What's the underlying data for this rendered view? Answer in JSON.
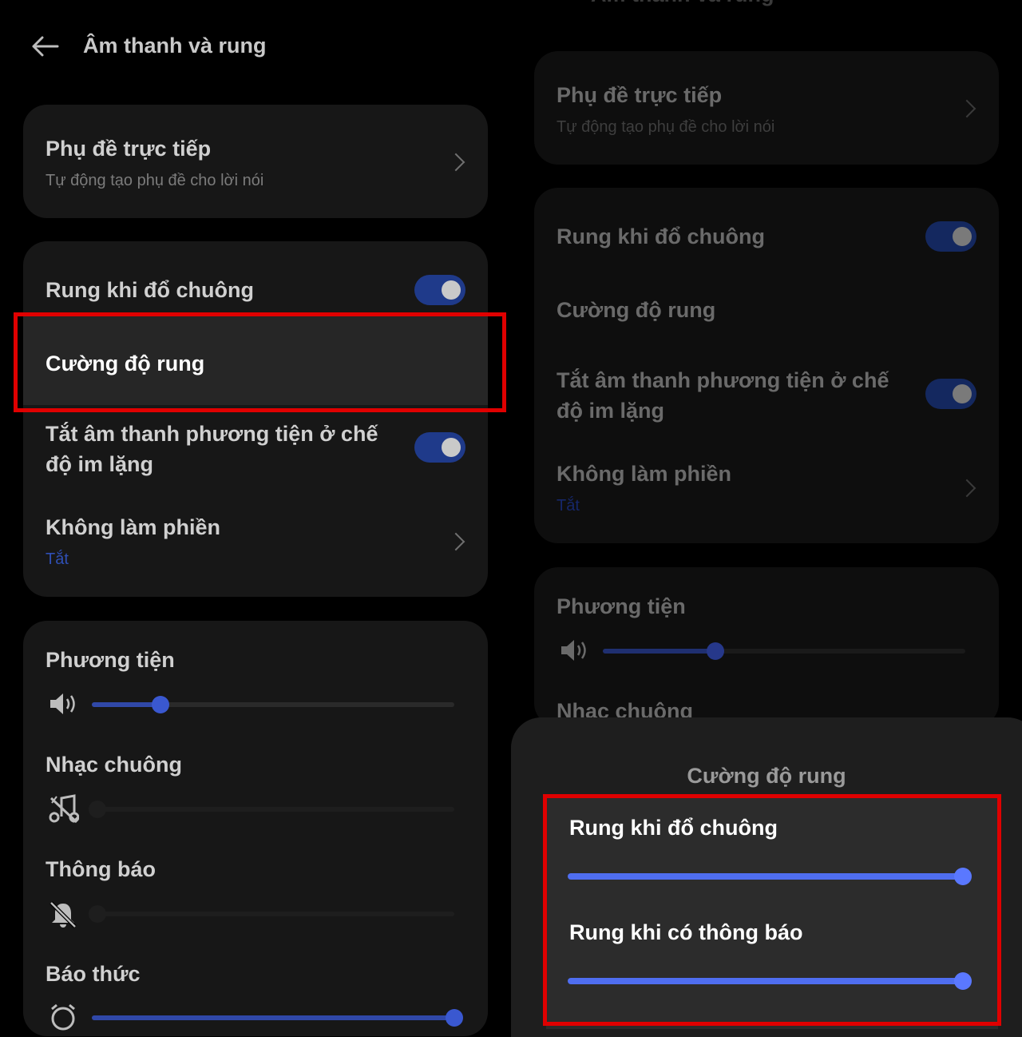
{
  "left": {
    "header": {
      "title": "Âm thanh và rung",
      "back_icon": "back-arrow-icon"
    },
    "live_caption": {
      "title": "Phụ đề trực tiếp",
      "subtitle": "Tự động tạo phụ đề cho lời nói"
    },
    "vibrate_ring": {
      "label": "Rung khi đổ chuông",
      "on": true
    },
    "vibration_intensity": {
      "label": "Cường độ rung"
    },
    "mute_media": {
      "label_line1": "Tắt âm thanh phương tiện ở chế",
      "label_line2": "độ im lặng",
      "on": true
    },
    "dnd": {
      "title": "Không làm phiền",
      "status": "Tắt"
    },
    "volumes": [
      {
        "label": "Phương tiện",
        "icon": "speaker-icon",
        "level": 0.19
      },
      {
        "label": "Nhạc chuông",
        "icon": "ringtone-muted-icon",
        "level": 0.0
      },
      {
        "label": "Thông báo",
        "icon": "notification-muted-icon",
        "level": 0.0
      },
      {
        "label": "Báo thức",
        "icon": "alarm-icon",
        "level": 1.0
      }
    ]
  },
  "right": {
    "header": {
      "title": "Âm thanh và rung"
    },
    "live_caption": {
      "title": "Phụ đề trực tiếp",
      "subtitle": "Tự động tạo phụ đề cho lời nói"
    },
    "vibrate_ring": {
      "label": "Rung khi đổ chuông",
      "on": true
    },
    "vibration_intensity": {
      "label": "Cường độ rung"
    },
    "mute_media": {
      "label_line1": "Tắt âm thanh phương tiện ở chế",
      "label_line2": "độ im lặng",
      "on": true
    },
    "dnd": {
      "title": "Không làm phiền",
      "status": "Tắt"
    },
    "media": {
      "label": "Phương tiện",
      "level": 0.31
    },
    "ringtone": {
      "label": "Nhạc chuông"
    },
    "sheet": {
      "title": "Cường độ rung",
      "ring_label": "Rung khi đổ chuông",
      "ring_level": 1.0,
      "notify_label": "Rung khi có thông báo",
      "notify_level": 1.0
    }
  },
  "colors": {
    "accent": "#5a78ff",
    "highlight": "#e00000",
    "dnd_status": "#2f4fb5"
  }
}
